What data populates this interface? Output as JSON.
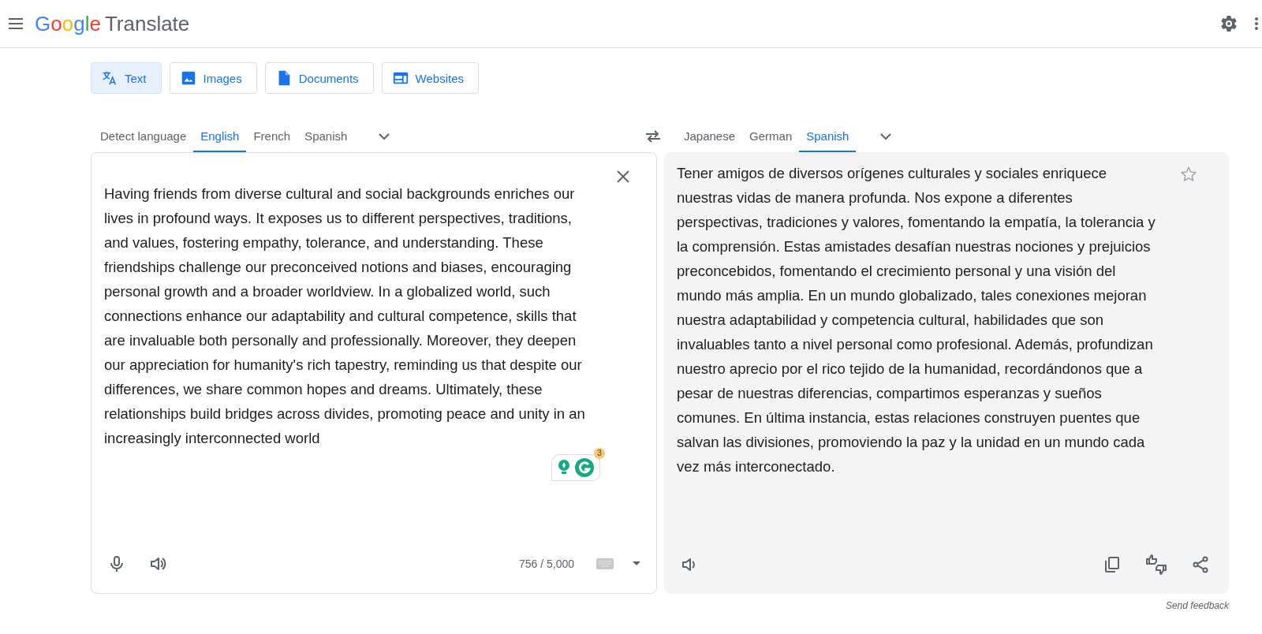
{
  "header": {
    "logo_brand": "Google",
    "logo_product": "Translate"
  },
  "mode_tabs": [
    {
      "label": "Text",
      "kind": "text",
      "selected": true
    },
    {
      "label": "Images",
      "kind": "images",
      "selected": false
    },
    {
      "label": "Documents",
      "kind": "documents",
      "selected": false
    },
    {
      "label": "Websites",
      "kind": "websites",
      "selected": false
    }
  ],
  "source_languages": [
    {
      "label": "Detect language",
      "selected": false
    },
    {
      "label": "English",
      "selected": true
    },
    {
      "label": "French",
      "selected": false
    },
    {
      "label": "Spanish",
      "selected": false
    }
  ],
  "target_languages": [
    {
      "label": "Japanese",
      "selected": false
    },
    {
      "label": "German",
      "selected": false
    },
    {
      "label": "Spanish",
      "selected": true
    }
  ],
  "source": {
    "text": "Having friends from diverse cultural and social backgrounds enriches our lives in profound ways. It exposes us to different perspectives, traditions, and values, fostering empathy, tolerance, and understanding. These friendships challenge our preconceived notions and biases, encouraging personal growth and a broader worldview. In a globalized world, such connections enhance our adaptability and cultural competence, skills that are invaluable both personally and professionally. Moreover, they deepen our appreciation for humanity's rich tapestry, reminding us that despite our differences, we share common hopes and dreams. Ultimately, these relationships build bridges across divides, promoting peace and unity in an increasingly interconnected world",
    "grammar_badge": "3",
    "char_count": "756 / 5,000"
  },
  "target": {
    "text": "Tener amigos de diversos orígenes culturales y sociales enriquece nuestras vidas de manera profunda. Nos expone a diferentes perspectivas, tradiciones y valores, fomentando la empatía, la tolerancia y la comprensión. Estas amistades desafían nuestras nociones y prejuicios preconcebidos, fomentando el crecimiento personal y una visión del mundo más amplia. En un mundo globalizado, tales conexiones mejoran nuestra adaptabilidad y competencia cultural, habilidades que son invaluables tanto a nivel personal como profesional. Además, profundizan nuestro aprecio por el rico tejido de la humanidad, recordándonos que a pesar de nuestras diferencias, compartimos esperanzas y sueños comunes. En última instancia, estas relaciones construyen puentes que salvan las divisiones, promoviendo la paz y la unidad en un mundo cada vez más interconectado.",
    "saved": false
  },
  "feedback_link": "Send feedback"
}
